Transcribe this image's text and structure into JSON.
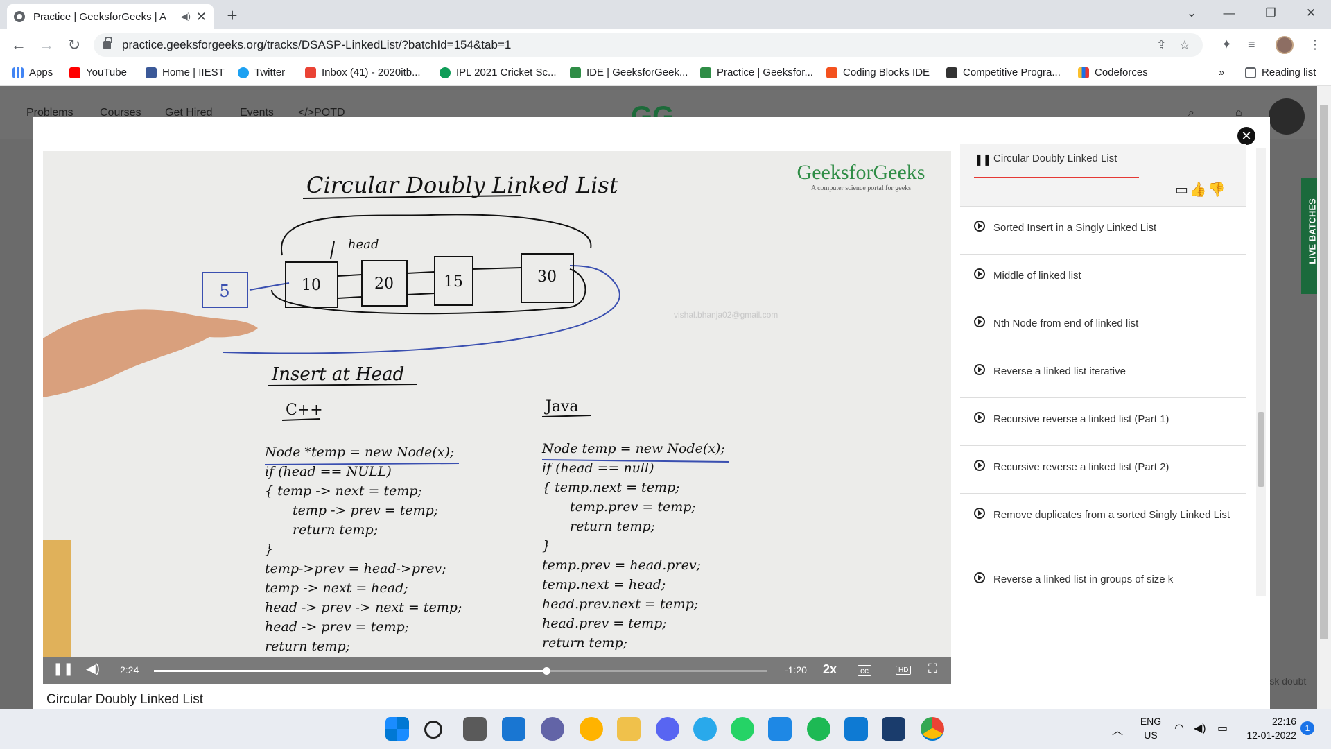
{
  "browser": {
    "tab_title": "Practice | GeeksforGeeks | A",
    "tab_audio": "◀)",
    "tab_close": "✕",
    "new_tab": "+",
    "url": "practice.geeksforgeeks.org/tracks/DSASP-LinkedList/?batchId=154&tab=1",
    "window_controls": {
      "dropdown": "⌄",
      "minimize": "—",
      "maximize": "❐",
      "close": "✕"
    }
  },
  "bookmarks": [
    {
      "label": "Apps",
      "color": "#4285f4"
    },
    {
      "label": "YouTube",
      "color": "#ff0000"
    },
    {
      "label": "Home | IIEST",
      "color": "#3b5998"
    },
    {
      "label": "Twitter",
      "color": "#1da1f2"
    },
    {
      "label": "Inbox (41) - 2020itb...",
      "color": "#ea4335"
    },
    {
      "label": "IPL 2021 Cricket Sc...",
      "color": "#0f9d58"
    },
    {
      "label": "IDE | GeeksforGeek...",
      "color": "#2f8d46"
    },
    {
      "label": "Practice | Geeksfor...",
      "color": "#2f8d46"
    },
    {
      "label": "Coding Blocks IDE",
      "color": "#f4511e"
    },
    {
      "label": "Competitive Progra...",
      "color": "#333333"
    },
    {
      "label": "Codeforces",
      "color": "#1a73e8"
    }
  ],
  "bookmarks_more": "»",
  "reading_list": "Reading list",
  "page_nav": [
    "Problems",
    "Courses",
    "Get Hired",
    "Events",
    "</>POTD"
  ],
  "page_logo": "GG",
  "side_tab": "LIVE BATCHES",
  "ask_doubt": "Ask doubt",
  "video": {
    "brand": "GeeksforGeeks",
    "brand_sub": "A computer science portal for geeks",
    "watermark": "vishal.bhanja02@gmail.com",
    "time_elapsed": "2:24",
    "time_remaining": "-1:20",
    "speed": "2x",
    "progress": 0.64,
    "caption": "Circular Doubly Linked List",
    "board": {
      "title": "Circular Doubly Linked List",
      "head_label": "head",
      "new_node": "5",
      "nodes": [
        "10",
        "20",
        "15",
        "30"
      ],
      "section": "Insert at Head",
      "cpp_title": "C++",
      "cpp_lines": [
        "Node *temp = new Node(x);",
        "if (head == NULL)",
        "{   temp -> next = temp;",
        "    temp -> prev = temp;",
        "    return temp;",
        "}",
        "temp->prev = head->prev;",
        "temp -> next = head;",
        "head -> prev -> next = temp;",
        "head -> prev = temp;",
        "return temp;"
      ],
      "java_title": "Java",
      "java_lines": [
        "Node temp = new Node(x);",
        "if (head == null)",
        "{   temp.next = temp;",
        "    temp.prev = temp;",
        "    return temp;",
        "}",
        "temp.prev = head.prev;",
        "temp.next = head;",
        "head.prev.next = temp;",
        "head.prev = temp;",
        "return temp;"
      ]
    }
  },
  "playlist": {
    "current": "Circular Doubly Linked List",
    "items": [
      "Sorted Insert in a Singly Linked List",
      "Middle of linked list",
      "Nth Node from end of linked list",
      "Reverse a linked list iterative",
      "Recursive reverse a linked list (Part 1)",
      "Recursive reverse a linked list (Part 2)",
      "Remove duplicates from a sorted Singly Linked List",
      "Reverse a linked list in groups of size k"
    ]
  },
  "taskbar": {
    "lang_top": "ENG",
    "lang_bottom": "US",
    "time": "22:16",
    "date": "12-01-2022",
    "notifications": "1"
  }
}
